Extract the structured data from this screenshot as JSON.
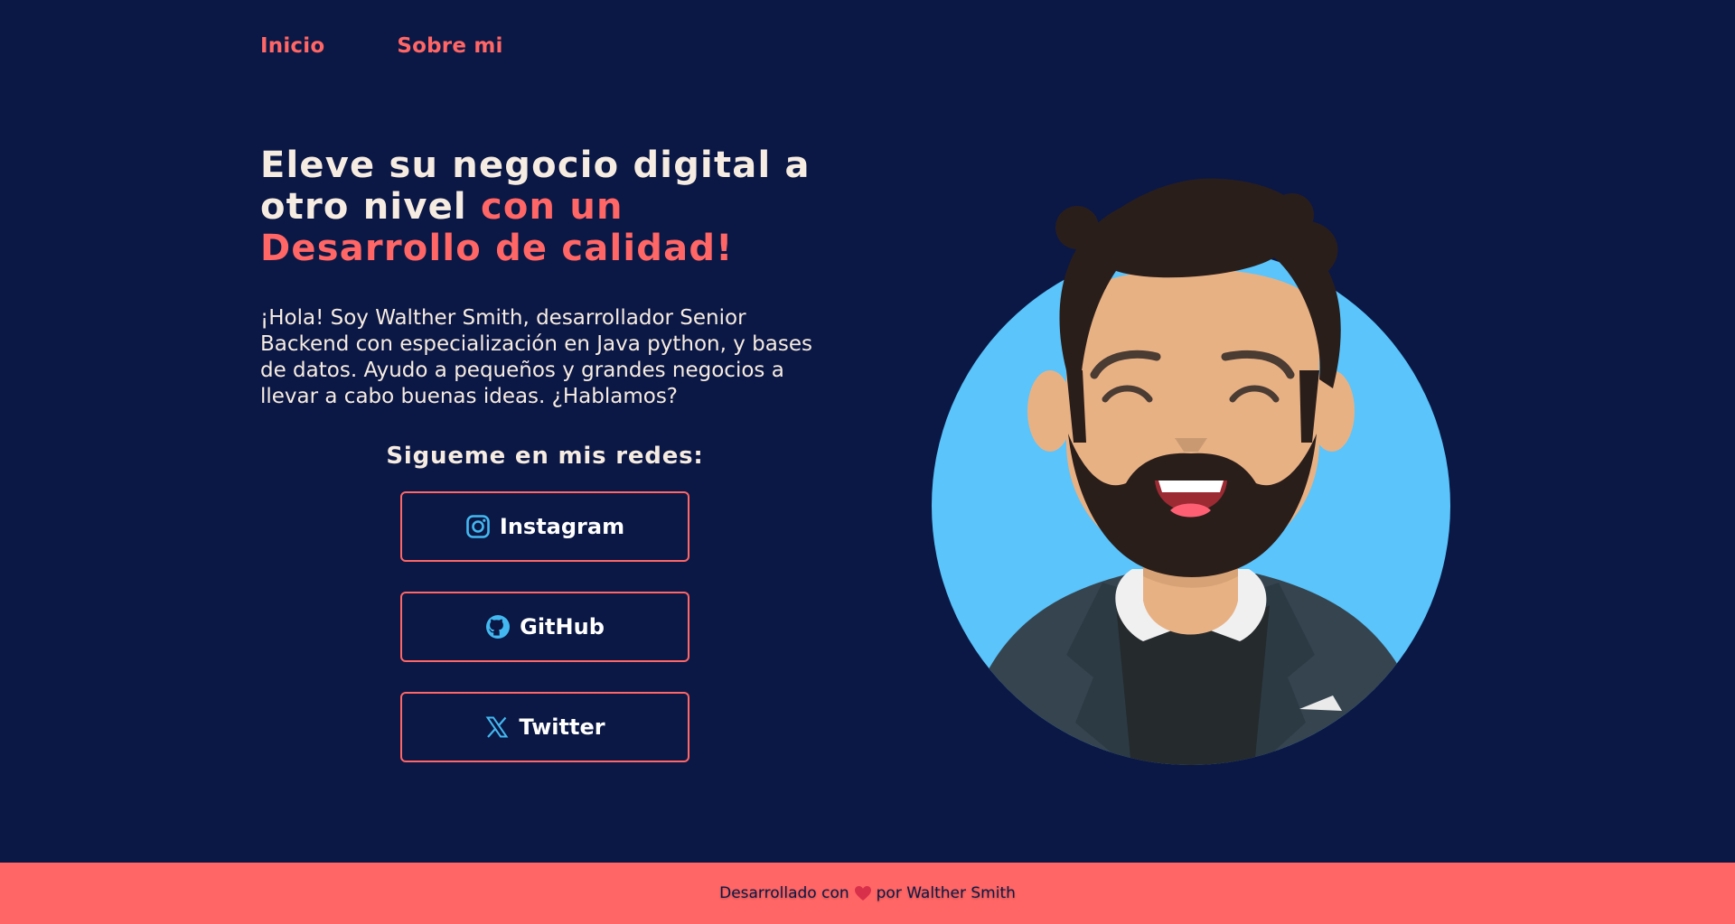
{
  "nav": {
    "links": [
      {
        "label": "Inicio"
      },
      {
        "label": "Sobre mi"
      }
    ]
  },
  "hero": {
    "headline_main": "Eleve su negocio digital a otro nivel ",
    "headline_accent": "con un Desarrollo de calidad!",
    "intro": "¡Hola! Soy Walther Smith, desarrollador Senior Backend con especialización en Java python, y bases de datos. Ayudo a pequeños y grandes negocios a llevar a cabo buenas ideas. ¿Hablamos?",
    "social_title": "Sigueme en mis redes:"
  },
  "social": [
    {
      "label": "Instagram",
      "icon": "instagram-icon"
    },
    {
      "label": "GitHub",
      "icon": "github-icon"
    },
    {
      "label": "Twitter",
      "icon": "x-twitter-icon"
    }
  ],
  "footer": {
    "prefix": "Desarrollado con",
    "suffix": "por Walther Smith",
    "icon": "heart-icon"
  },
  "colors": {
    "background": "#0b1845",
    "accent": "#ff6665",
    "text": "#f7ece1",
    "icon": "#43b8f0",
    "avatar_bg": "#5ac4fb"
  }
}
